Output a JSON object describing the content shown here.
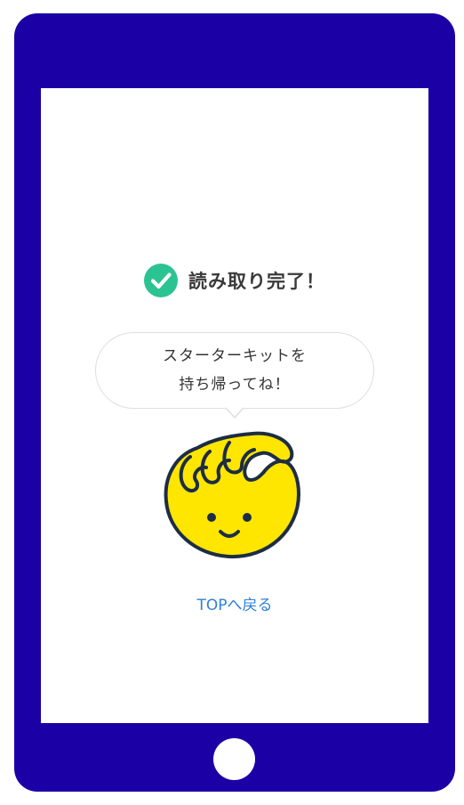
{
  "status": {
    "title": "読み取り完了！",
    "icon": "check-circle-icon",
    "icon_color": "#2cc392"
  },
  "bubble": {
    "line1": "スターターキットを",
    "line2": "持ち帰ってね！"
  },
  "mascot": {
    "icon": "mascot-character",
    "fill_color": "#ffe600",
    "outline_color": "#1d2d44"
  },
  "link": {
    "top_label": "TOPへ戻る",
    "color": "#2f7fd6"
  },
  "colors": {
    "device_frame": "#1b00a6",
    "screen_bg": "#ffffff"
  }
}
